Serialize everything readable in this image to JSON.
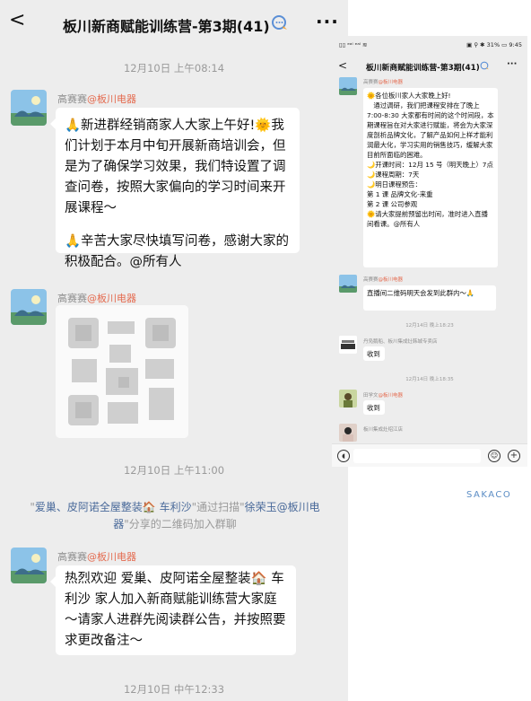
{
  "left": {
    "header": {
      "back": "<",
      "title": "板川新商赋能训练营-第3期(41)",
      "more": "···"
    },
    "time1": "12月10日 上午08:14",
    "msg1": {
      "sender_name": "高赛赛",
      "sender_org": "@板川电器",
      "p1": "🙏新进群经销商家人大家上午好!🌞我们计划于本月中旬开展新商培训会，但是为了确保学习效果，我们特设置了调查问卷，按照大家偏向的学习时间来开展课程～",
      "p2": "🙏辛苦大家尽快填写问卷，感谢大家的积极配合。@所有人"
    },
    "msg2": {
      "sender_name": "高赛赛",
      "sender_org": "@板川电器"
    },
    "time2": "12月10日 上午11:00",
    "system": {
      "q1": "\"",
      "name1": "爱巢、皮阿诺全屋整装🏠 车利沙",
      "via": "\"通过扫描\"",
      "name2": "徐荣玉@板川电器",
      "tail": "\"分享的二维码加入群聊"
    },
    "msg3": {
      "sender_name": "高赛赛",
      "sender_org": "@板川电器",
      "text": "热烈欢迎 爱巢、皮阿诺全屋整装🏠 车利沙 家人加入新商赋能训练营大家庭～请家人进群先阅读群公告，并按照要求更改备注～"
    },
    "time3": "12月10日 中午12:33"
  },
  "right": {
    "status_left": "▯▯ ᵉᵃˡ ᵉᵃˡ ≋",
    "status_right": "▣ ⚲ ✱ 31% ▭ 9:45",
    "header": {
      "back": "<",
      "title": "板川新商赋能训练营-第3期(41)",
      "more": "···"
    },
    "msg1": {
      "sender_name": "高赛赛",
      "sender_org": "@板川电器",
      "lines": [
        "🌞各位板川家人大家晚上好!",
        "　通过调研，我们把课程安排在了晚上 7:00-8:30 大家都有时间的这个时间段，本期课程旨在对大家进行赋能，将会为大家深度剖析品牌文化，了解产品如何上样才能利润最大化，学习实用的销售技巧，缓解大家目前所面临的困难。",
        "🌙开课时间：12月 15 号（明天晚上）7点",
        "🌙课程周期：7天",
        "🌙明日课程预告：",
        "第 1 课  品牌文化-来重",
        "第 2 课  公司参观",
        "🌞请大家提前预留出时间，准时进入直播间看课。@所有人"
      ]
    },
    "msg2": {
      "sender_name": "高赛赛",
      "sender_org": "@板川电器",
      "text": "直播间二维码明天会发到此群内～🙏"
    },
    "time1": "12月14日 晚上18:23",
    "msg3": {
      "sender_name": "丹凫鹅船、板川集成灶韩城专卖店",
      "text": "收到"
    },
    "time2": "12月14日 晚上18:35",
    "msg4": {
      "sender_name": "田学文",
      "sender_org": "@板川电器",
      "text": "收到"
    },
    "msg5": {
      "sender_name": "板川集成灶绍江店"
    }
  },
  "watermark": "SAKACO"
}
